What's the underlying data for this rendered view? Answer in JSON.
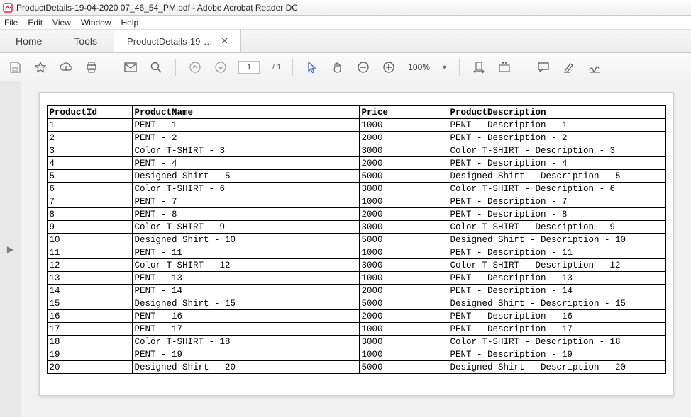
{
  "window": {
    "title": "ProductDetails-19-04-2020 07_46_54_PM.pdf - Adobe Acrobat Reader DC"
  },
  "menu": {
    "items": [
      "File",
      "Edit",
      "View",
      "Window",
      "Help"
    ]
  },
  "tabs": {
    "home": "Home",
    "tools": "Tools",
    "doc": "ProductDetails-19-…"
  },
  "toolbar": {
    "page_current": "1",
    "page_total": "/ 1",
    "zoom": "100%"
  },
  "table": {
    "headers": {
      "id": "ProductId",
      "name": "ProductName",
      "price": "Price",
      "desc": "ProductDescription"
    },
    "rows": [
      {
        "id": "1",
        "name": "PENT - 1",
        "price": "1000",
        "desc": "PENT - Description - 1"
      },
      {
        "id": "2",
        "name": "PENT - 2",
        "price": "2000",
        "desc": "PENT - Description - 2"
      },
      {
        "id": "3",
        "name": "Color T-SHIRT - 3",
        "price": "3000",
        "desc": "Color T-SHIRT - Description - 3"
      },
      {
        "id": "4",
        "name": "PENT - 4",
        "price": "2000",
        "desc": "PENT - Description - 4"
      },
      {
        "id": "5",
        "name": "Designed Shirt - 5",
        "price": "5000",
        "desc": "Designed Shirt - Description - 5"
      },
      {
        "id": "6",
        "name": "Color T-SHIRT - 6",
        "price": "3000",
        "desc": "Color T-SHIRT - Description - 6"
      },
      {
        "id": "7",
        "name": "PENT - 7",
        "price": "1000",
        "desc": "PENT - Description - 7"
      },
      {
        "id": "8",
        "name": "PENT - 8",
        "price": "2000",
        "desc": "PENT - Description - 8"
      },
      {
        "id": "9",
        "name": "Color T-SHIRT - 9",
        "price": "3000",
        "desc": "Color T-SHIRT - Description - 9"
      },
      {
        "id": "10",
        "name": "Designed Shirt - 10",
        "price": "5000",
        "desc": "Designed Shirt - Description - 10"
      },
      {
        "id": "11",
        "name": "PENT - 11",
        "price": "1000",
        "desc": "PENT - Description - 11"
      },
      {
        "id": "12",
        "name": "Color T-SHIRT - 12",
        "price": "3000",
        "desc": "Color T-SHIRT - Description - 12"
      },
      {
        "id": "13",
        "name": "PENT - 13",
        "price": "1000",
        "desc": "PENT - Description - 13"
      },
      {
        "id": "14",
        "name": "PENT - 14",
        "price": "2000",
        "desc": "PENT - Description - 14"
      },
      {
        "id": "15",
        "name": "Designed Shirt - 15",
        "price": "5000",
        "desc": "Designed Shirt - Description - 15"
      },
      {
        "id": "16",
        "name": "PENT - 16",
        "price": "2000",
        "desc": "PENT - Description - 16"
      },
      {
        "id": "17",
        "name": "PENT - 17",
        "price": "1000",
        "desc": "PENT - Description - 17"
      },
      {
        "id": "18",
        "name": "Color T-SHIRT - 18",
        "price": "3000",
        "desc": "Color T-SHIRT - Description - 18"
      },
      {
        "id": "19",
        "name": "PENT - 19",
        "price": "1000",
        "desc": "PENT - Description - 19"
      },
      {
        "id": "20",
        "name": "Designed Shirt - 20",
        "price": "5000",
        "desc": "Designed Shirt - Description - 20"
      }
    ]
  }
}
